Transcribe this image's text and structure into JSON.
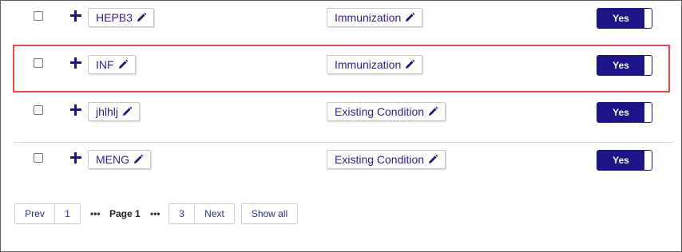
{
  "rows": [
    {
      "code": "HEPB3",
      "category": "Immunization",
      "status": "Yes"
    },
    {
      "code": "INF",
      "category": "Immunization",
      "status": "Yes"
    },
    {
      "code": "jhlhlj",
      "category": "Existing Condition",
      "status": "Yes"
    },
    {
      "code": "MENG",
      "category": "Existing Condition",
      "status": "Yes"
    }
  ],
  "pagination": {
    "prev_label": "Prev",
    "first_page": "1",
    "ellipsis": "•••",
    "current_page_label": "Page 1",
    "last_page": "3",
    "next_label": "Next",
    "show_all_label": "Show all"
  },
  "colors": {
    "accent": "#1d148a",
    "link": "#2a1f98",
    "highlight": "#e8484e"
  },
  "icons": {
    "expand": "plus-icon",
    "edit": "pencil-icon"
  }
}
